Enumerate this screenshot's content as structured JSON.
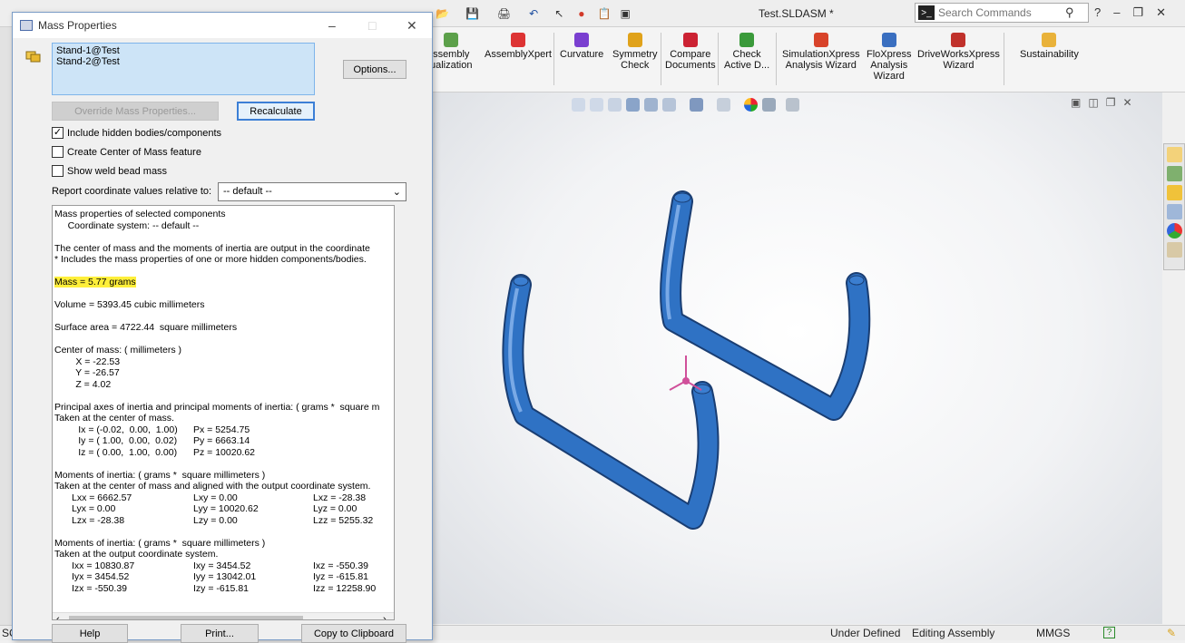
{
  "app": {
    "title": "Test.SLDASM *",
    "search_placeholder": "Search Commands"
  },
  "ribbon": {
    "items": [
      {
        "label": "ssembly\nualization",
        "icon": "assembly-visualization-icon"
      },
      {
        "label": "AssemblyXpert",
        "icon": "assemblyxpert-icon"
      },
      {
        "label": "Curvature",
        "icon": "curvature-icon"
      },
      {
        "label": "Symmetry\nCheck",
        "icon": "symmetry-check-icon"
      },
      {
        "label": "Compare\nDocuments",
        "icon": "compare-documents-icon"
      },
      {
        "label": "Check\nActive D...",
        "icon": "check-active-icon"
      },
      {
        "label": "SimulationXpress\nAnalysis Wizard",
        "icon": "simulationxpress-icon"
      },
      {
        "label": "FloXpress\nAnalysis\nWizard",
        "icon": "floxpress-icon"
      },
      {
        "label": "DriveWorksXpress\nWizard",
        "icon": "driveworksxpress-icon"
      },
      {
        "label": "Sustainability",
        "icon": "sustainability-icon"
      }
    ]
  },
  "dialog": {
    "title": "Mass Properties",
    "components": [
      "Stand-1@Test",
      "Stand-2@Test"
    ],
    "options_label": "Options...",
    "override_label": "Override Mass Properties...",
    "recalculate_label": "Recalculate",
    "checkboxes": [
      {
        "label": "Include hidden bodies/components",
        "checked": true
      },
      {
        "label": "Create Center of Mass feature",
        "checked": false
      },
      {
        "label": "Show weld bead mass",
        "checked": false
      }
    ],
    "report_label": "Report coordinate values relative to:",
    "report_value": "-- default --",
    "output": {
      "heading": "Mass properties of selected components",
      "coord_system": "     Coordinate system: -- default --",
      "note1": "The center of mass and the moments of inertia are output in the coordinate",
      "note2": "* Includes the mass properties of one or more hidden components/bodies.",
      "mass": "Mass = 5.77 grams",
      "volume": "Volume = 5393.45 cubic millimeters",
      "surface": "Surface area = 4722.44  square millimeters",
      "com_heading": "Center of mass: ( millimeters )",
      "com_x": "        X = -22.53",
      "com_y": "        Y = -26.57",
      "com_z": "        Z = 4.02",
      "principal_heading": "Principal axes of inertia and principal moments of inertia: ( grams *  square m",
      "principal_taken": "Taken at the center of mass.",
      "ix": "         Ix = (-0.02,  0.00,  1.00)",
      "px": "Px = 5254.75",
      "iy": "         Iy = ( 1.00,  0.00,  0.02)",
      "py": "Py = 6663.14",
      "iz": "         Iz = ( 0.00,  1.00,  0.00)",
      "pz": "Pz = 10020.62",
      "moi1_heading": "Moments of inertia: ( grams *  square millimeters )",
      "moi1_taken": "Taken at the center of mass and aligned with the output coordinate system.",
      "moi1": [
        [
          "Lxx = 6662.57",
          "Lxy = 0.00",
          "Lxz = -28.38"
        ],
        [
          "Lyx = 0.00",
          "Lyy = 10020.62",
          "Lyz = 0.00"
        ],
        [
          "Lzx = -28.38",
          "Lzy = 0.00",
          "Lzz = 5255.32"
        ]
      ],
      "moi2_heading": "Moments of inertia: ( grams *  square millimeters )",
      "moi2_taken": "Taken at the output coordinate system.",
      "moi2": [
        [
          "Ixx = 10830.87",
          "Ixy = 3454.52",
          "Ixz = -550.39"
        ],
        [
          "Iyx = 3454.52",
          "Iyy = 13042.01",
          "Iyz = -615.81"
        ],
        [
          "Izx = -550.39",
          "Izy = -615.81",
          "Izz = 12258.90"
        ]
      ]
    },
    "help_label": "Help",
    "print_label": "Print...",
    "copy_label": "Copy to Clipboard"
  },
  "status": {
    "left": "SC",
    "state": "Under Defined",
    "mode": "Editing Assembly",
    "units": "MMGS"
  },
  "colors": {
    "part_blue": "#2f72c4",
    "highlight": "#ffef3a",
    "list_bg": "#cde4f7"
  }
}
